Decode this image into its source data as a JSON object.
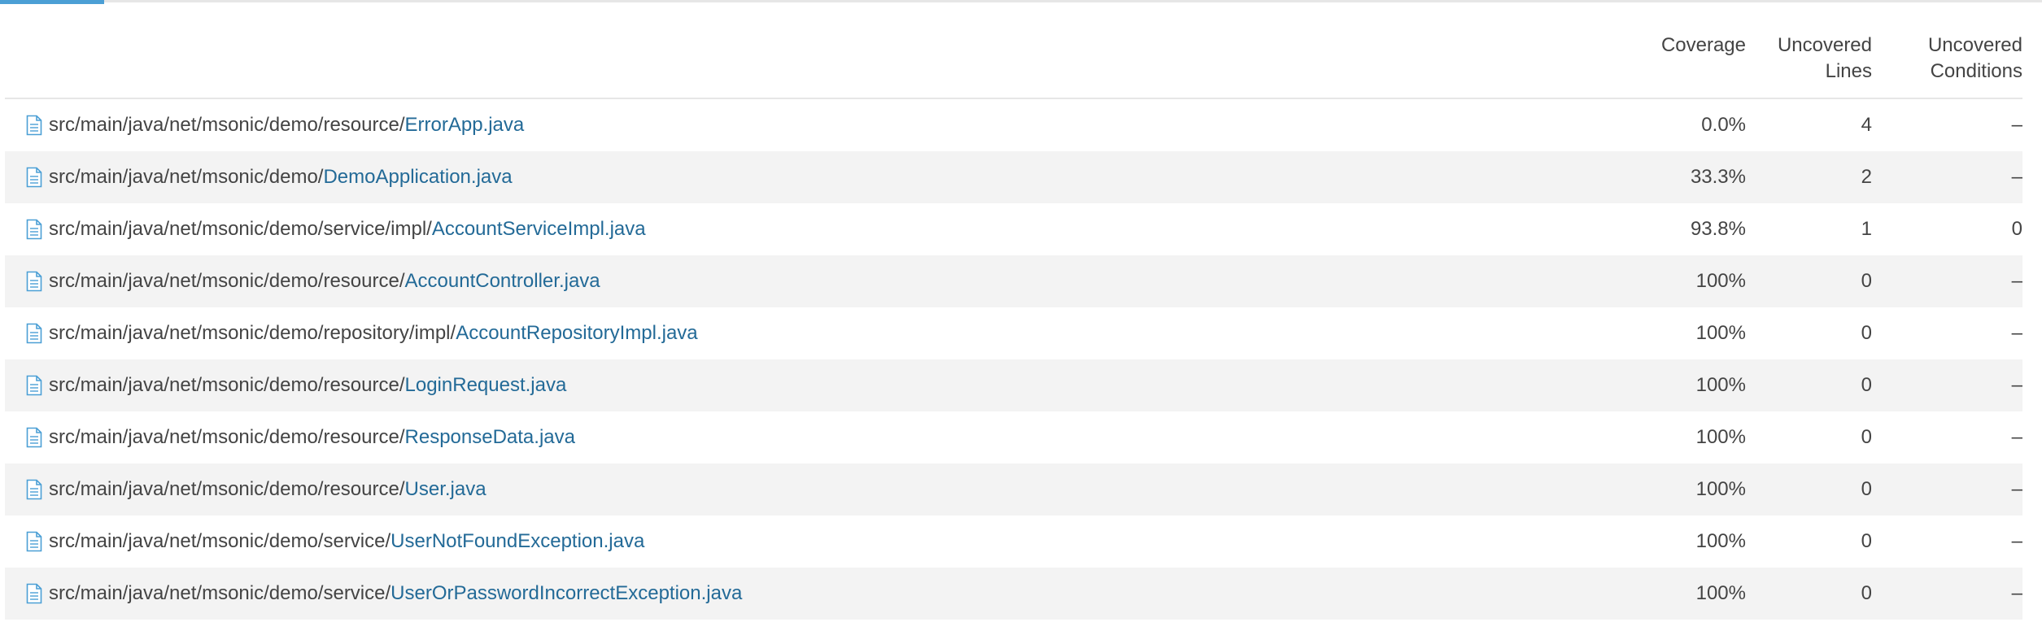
{
  "header": {
    "coverage": "Coverage",
    "uncovered_lines": [
      "Uncovered",
      "Lines"
    ],
    "uncovered_conditions": [
      "Uncovered",
      "Conditions"
    ]
  },
  "icons": {
    "file": "file-icon"
  },
  "colors": {
    "link": "#236a97",
    "accent": "#4b9fd5",
    "row_alt": "#f3f3f3"
  },
  "rows": [
    {
      "dir": "src/main/java/net/msonic/demo/resource/",
      "file": "ErrorApp.java",
      "coverage": "0.0%",
      "lines": "4",
      "conditions": "–"
    },
    {
      "dir": "src/main/java/net/msonic/demo/",
      "file": "DemoApplication.java",
      "coverage": "33.3%",
      "lines": "2",
      "conditions": "–"
    },
    {
      "dir": "src/main/java/net/msonic/demo/service/impl/",
      "file": "AccountServiceImpl.java",
      "coverage": "93.8%",
      "lines": "1",
      "conditions": "0"
    },
    {
      "dir": "src/main/java/net/msonic/demo/resource/",
      "file": "AccountController.java",
      "coverage": "100%",
      "lines": "0",
      "conditions": "–"
    },
    {
      "dir": "src/main/java/net/msonic/demo/repository/impl/",
      "file": "AccountRepositoryImpl.java",
      "coverage": "100%",
      "lines": "0",
      "conditions": "–"
    },
    {
      "dir": "src/main/java/net/msonic/demo/resource/",
      "file": "LoginRequest.java",
      "coverage": "100%",
      "lines": "0",
      "conditions": "–"
    },
    {
      "dir": "src/main/java/net/msonic/demo/resource/",
      "file": "ResponseData.java",
      "coverage": "100%",
      "lines": "0",
      "conditions": "–"
    },
    {
      "dir": "src/main/java/net/msonic/demo/resource/",
      "file": "User.java",
      "coverage": "100%",
      "lines": "0",
      "conditions": "–"
    },
    {
      "dir": "src/main/java/net/msonic/demo/service/",
      "file": "UserNotFoundException.java",
      "coverage": "100%",
      "lines": "0",
      "conditions": "–"
    },
    {
      "dir": "src/main/java/net/msonic/demo/service/",
      "file": "UserOrPasswordIncorrectException.java",
      "coverage": "100%",
      "lines": "0",
      "conditions": "–"
    }
  ]
}
